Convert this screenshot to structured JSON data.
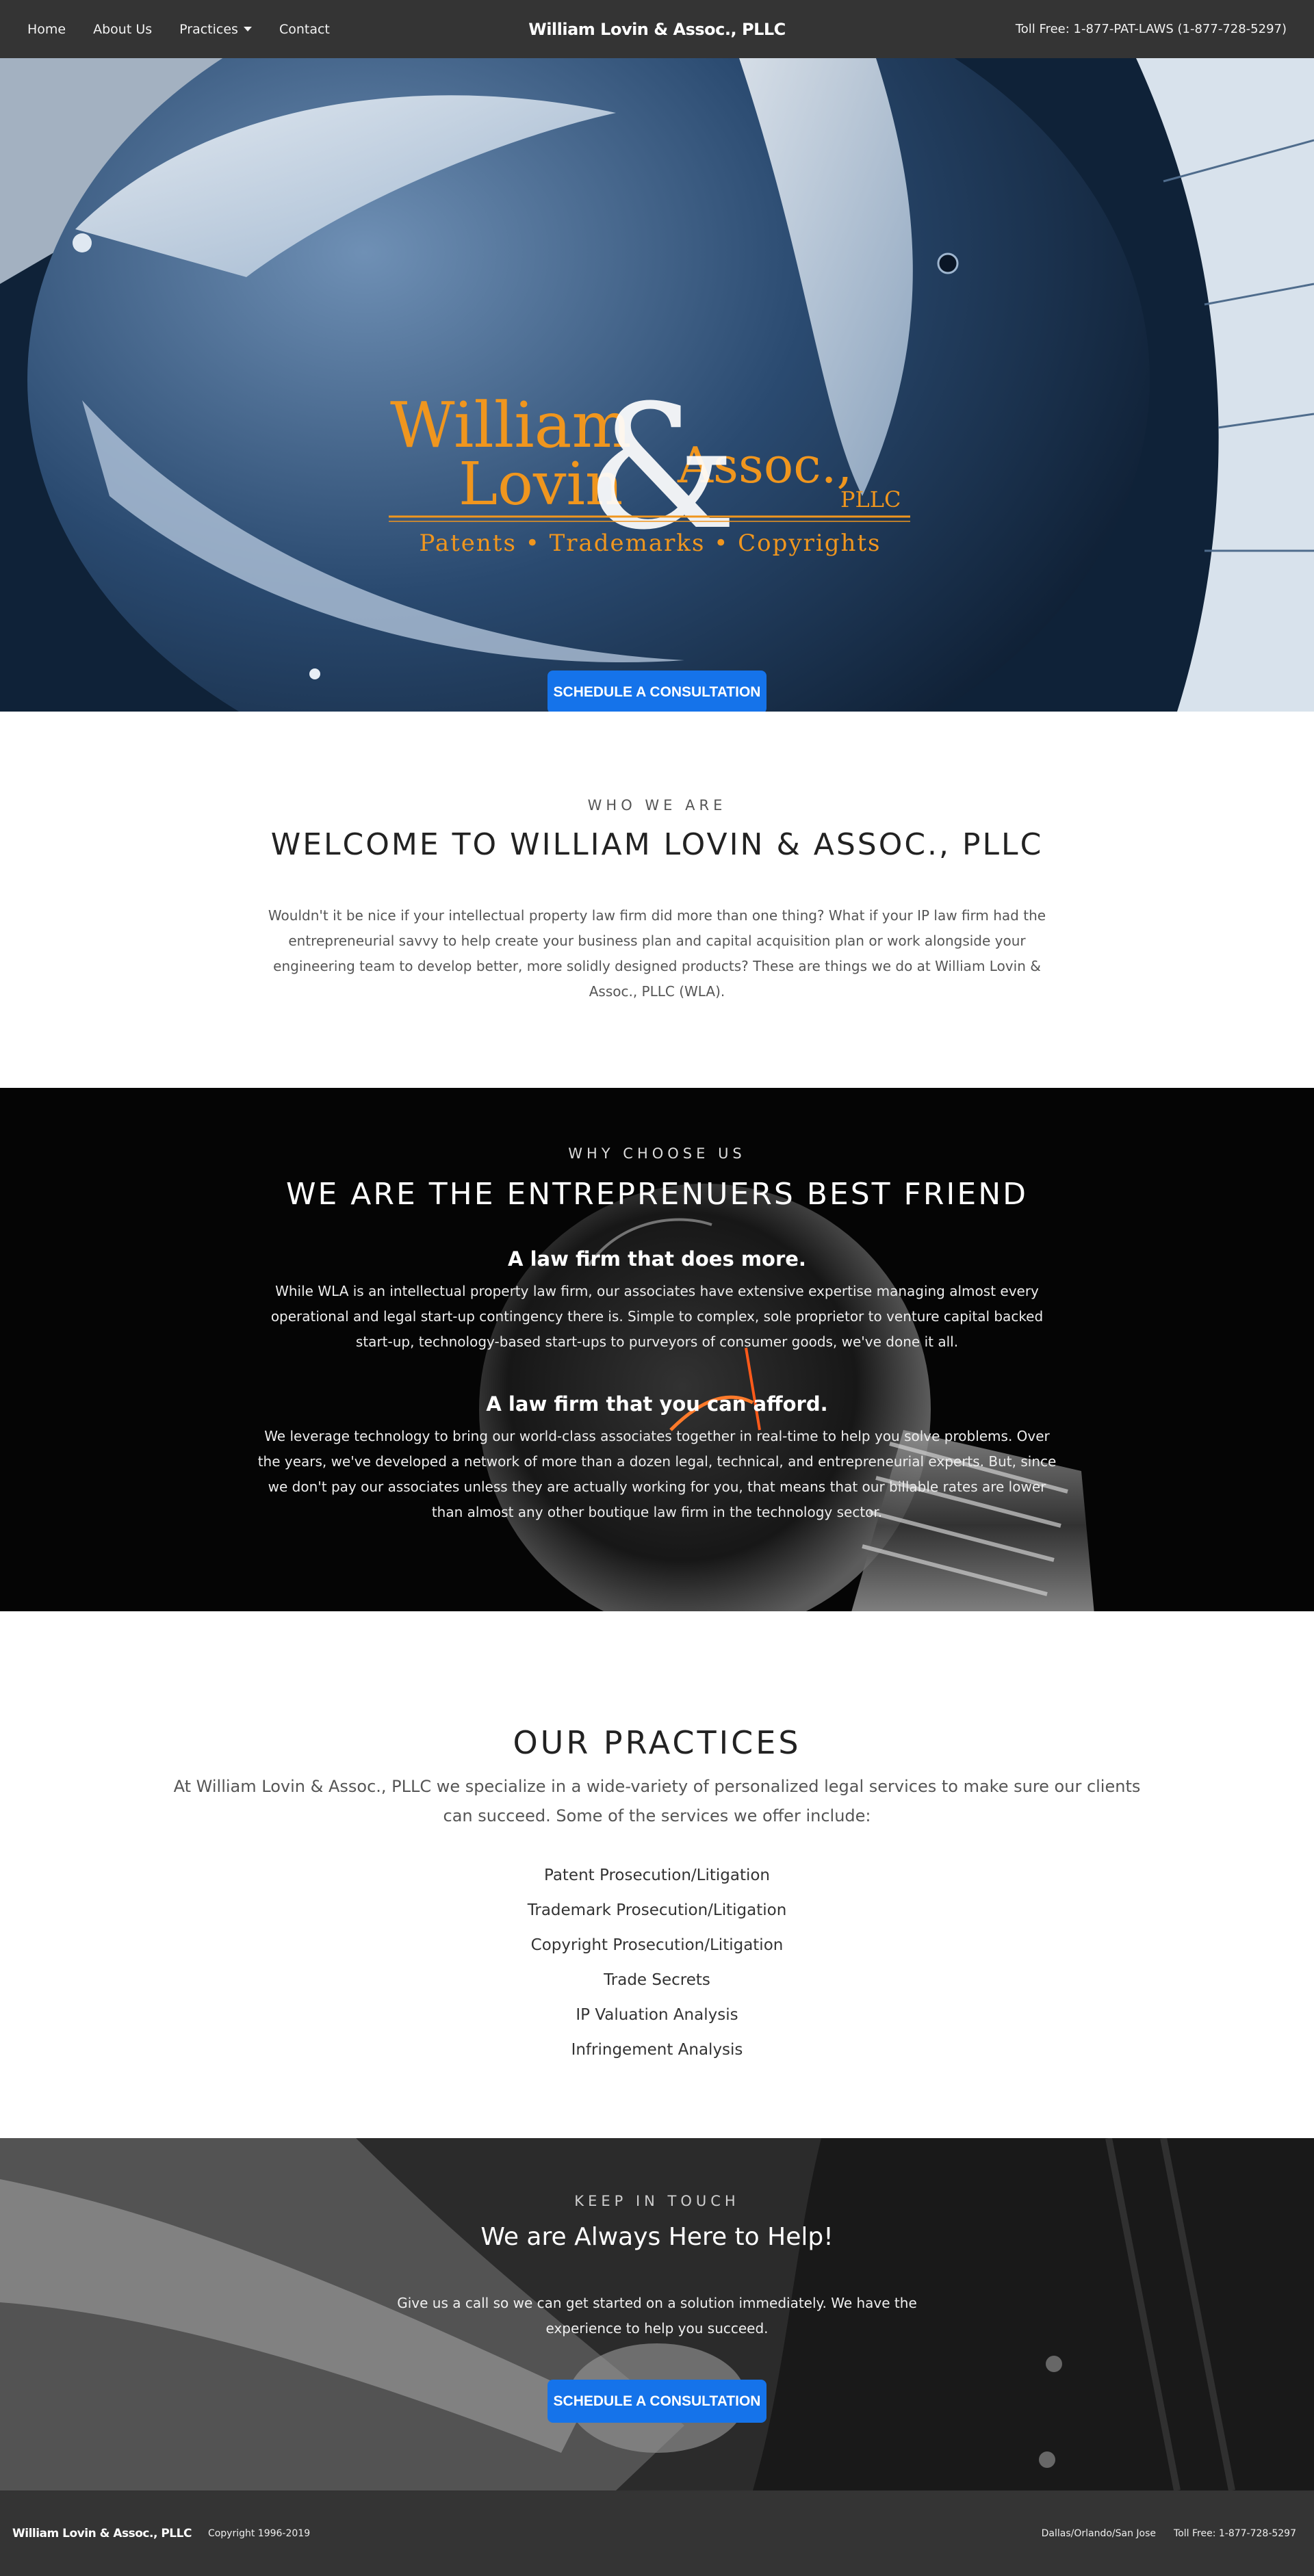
{
  "navbar": {
    "links": [
      "Home",
      "About Us",
      "Practices",
      "Contact"
    ],
    "brand": "William Lovin & Assoc., PLLC",
    "toll_free": "Toll Free: 1-877-PAT-LAWS (1-877-728-5297)"
  },
  "hero": {
    "logo": {
      "line1a": "William",
      "line1b": "Assoc.,",
      "line2a": "Lovin",
      "line2b": "PLLC",
      "ampersand": "&",
      "tagline": "Patents • Trademarks • Copyrights"
    },
    "cta_label": "SCHEDULE A CONSULTATION"
  },
  "welcome": {
    "eyebrow": "WHO WE ARE",
    "title": "WELCOME TO WILLIAM LOVIN & ASSOC., PLLC",
    "body": "Wouldn't it be nice if your intellectual property law firm did more than one thing? What if your IP law firm had the entrepreneurial savvy to help create your business plan and capital acquisition plan or work alongside your engineering team to develop better, more solidly designed products? These are things we do at William Lovin & Assoc., PLLC (WLA)."
  },
  "why": {
    "eyebrow": "WHY CHOOSE US",
    "title": "WE ARE THE ENTREPRENUERS BEST FRIEND",
    "heading1": "A law firm that does more.",
    "body1": "While WLA is an intellectual property law firm, our associates have extensive expertise managing almost every operational and legal start-up contingency there is. Simple to complex, sole proprietor to venture capital backed start-up, technology-based start-ups to purveyors of consumer goods, we've done it all.",
    "heading2": "A law firm that you can afford.",
    "body2": "We leverage technology to bring our world-class associates together in real-time to help you solve problems. Over the years, we've developed a network of more than a dozen legal, technical, and entrepreneurial experts. But, since we don't pay our associates unless they are actually working for you, that means that our billable rates are lower than almost any other boutique law firm in the technology sector."
  },
  "practices": {
    "title": "OUR PRACTICES",
    "intro": "At William Lovin & Assoc., PLLC we specialize in a wide-variety of personalized legal services to make sure our clients can succeed. Some of the services we offer include:",
    "items": [
      "Patent Prosecution/Litigation",
      "Trademark Prosecution/Litigation",
      "Copyright Prosecution/Litigation",
      "Trade Secrets",
      "IP Valuation Analysis",
      "Infringement Analysis"
    ]
  },
  "contact": {
    "eyebrow": "KEEP IN TOUCH",
    "title": "We are Always Here to Help!",
    "body": "Give us a call so we can get started on a solution immediately. We have the experience to help you succeed.",
    "cta_label": "SCHEDULE A CONSULTATION"
  },
  "footer": {
    "brand": "William Lovin & Assoc., PLLC",
    "copyright": "Copyright 1996-2019",
    "locations": "Dallas/Orlando/San Jose",
    "toll_free": "Toll Free: 1-877-728-5297"
  },
  "colors": {
    "nav_bg": "#343434",
    "logo_orange": "#f0961e",
    "button_blue": "#1573ea"
  }
}
